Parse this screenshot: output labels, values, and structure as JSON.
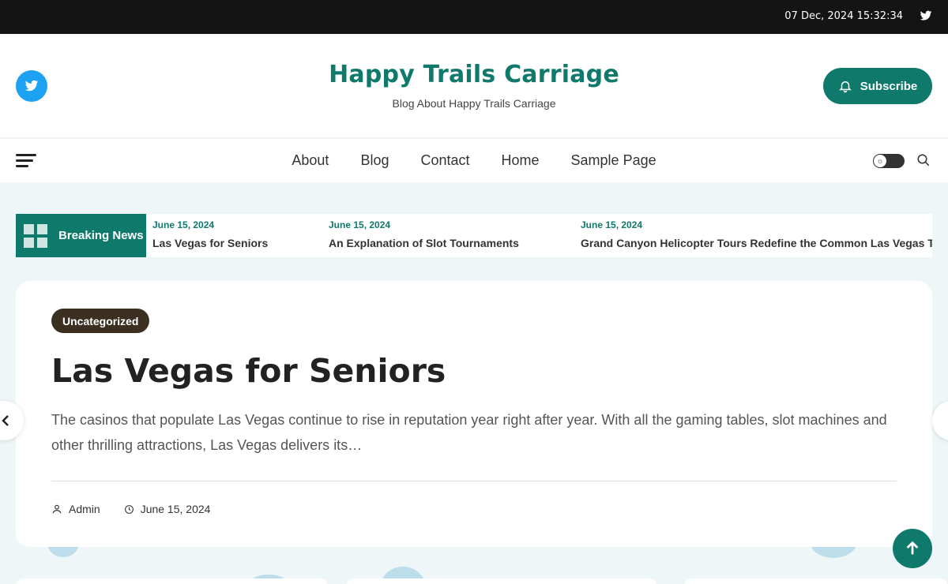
{
  "topbar": {
    "datetime": "07 Dec, 2024 15:32:34",
    "social_icon": "twitter-icon"
  },
  "header": {
    "site_title": "Happy Trails Carriage",
    "tagline": "Blog About Happy Trails Carriage",
    "subscribe_label": "Subscribe",
    "social_icon": "twitter-icon"
  },
  "nav": {
    "items": [
      "About",
      "Blog",
      "Contact",
      "Home",
      "Sample Page"
    ]
  },
  "breaking": {
    "label": "Breaking News",
    "items": [
      {
        "date": "June 15, 2024",
        "title": "Las Vegas for Seniors"
      },
      {
        "date": "June 15, 2024",
        "title": "An Explanation of Slot Tournaments"
      },
      {
        "date": "June 15, 2024",
        "title": "Grand Canyon Helicopter Tours Redefine the Common Las Vegas Trip"
      }
    ]
  },
  "post": {
    "category": "Uncategorized",
    "title": "Las Vegas for Seniors",
    "excerpt": "The casinos that populate Las Vegas continue to rise in reputation year right after year. With all the gaming tables, slot machines and other thrilling attractions, Las Vegas delivers its…",
    "author": "Admin",
    "date": "June 15, 2024"
  },
  "colors": {
    "accent": "#0f7a6c",
    "topbar": "#141414",
    "twitter": "#1da1f2",
    "category_bg": "#3b2f22"
  }
}
